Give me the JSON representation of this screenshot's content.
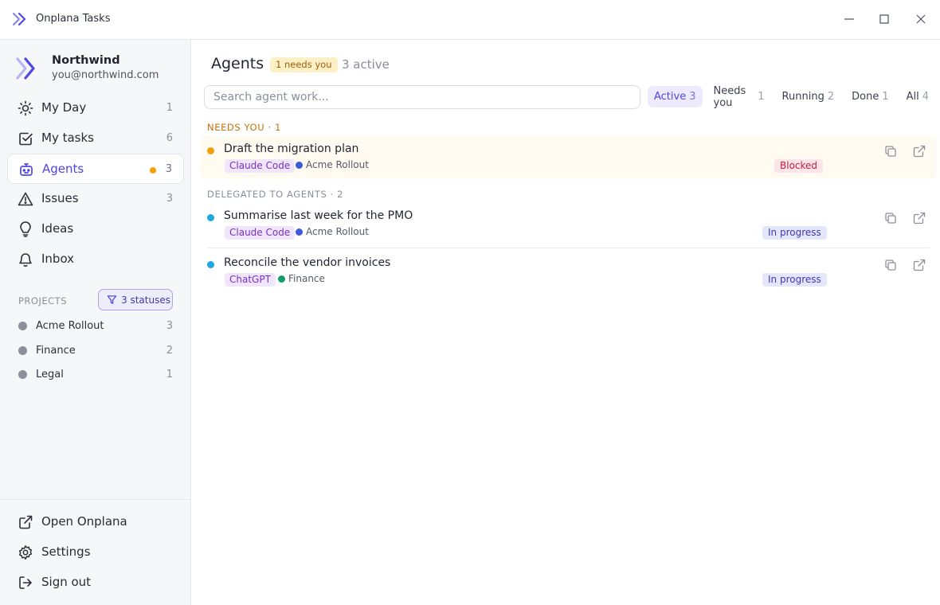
{
  "window": {
    "title": "Onplana Tasks",
    "controls": {
      "minimize": "minimize-icon",
      "maximize": "maximize-icon",
      "close": "close-icon"
    }
  },
  "sidebar": {
    "org": {
      "name": "Northwind",
      "email": "you@northwind.com"
    },
    "nav": [
      {
        "label": "My Day",
        "count": "1",
        "icon": "sun-icon"
      },
      {
        "label": "My tasks",
        "count": "6",
        "icon": "checkbox-icon"
      },
      {
        "label": "Agents",
        "count": "3",
        "icon": "robot-icon",
        "active": true,
        "alert": true
      },
      {
        "label": "Issues",
        "count": "3",
        "icon": "warning-icon"
      },
      {
        "label": "Ideas",
        "count": "",
        "icon": "lightbulb-icon"
      },
      {
        "label": "Inbox",
        "count": "",
        "icon": "bell-icon"
      }
    ],
    "projects_heading": "PROJECTS",
    "status_filter": "3 statuses",
    "projects": [
      {
        "label": "Acme Rollout",
        "count": "3"
      },
      {
        "label": "Finance",
        "count": "2"
      },
      {
        "label": "Legal",
        "count": "1"
      }
    ],
    "footer": [
      {
        "label": "Open Onplana",
        "icon": "external-link-icon"
      },
      {
        "label": "Settings",
        "icon": "gear-icon"
      },
      {
        "label": "Sign out",
        "icon": "sign-out-icon"
      }
    ]
  },
  "main": {
    "title": "Agents",
    "needs_badge": "1 needs you",
    "active_count": "3 active",
    "search": {
      "placeholder": "Search agent work...",
      "value": ""
    },
    "tabs": [
      {
        "label": "Active",
        "count": "3",
        "active": true
      },
      {
        "label": "Needs you",
        "count": "1"
      },
      {
        "label": "Running",
        "count": "2"
      },
      {
        "label": "Done",
        "count": "1"
      },
      {
        "label": "All",
        "count": "4"
      }
    ],
    "sections": [
      {
        "heading": "NEEDS YOU · 1",
        "tasks": [
          {
            "title": "Draft the migration plan",
            "agent": "Claude Code",
            "project": "Acme Rollout",
            "status": "Blocked"
          }
        ]
      },
      {
        "heading": "DELEGATED TO AGENTS · 2",
        "tasks": [
          {
            "title": "Summarise last week for the PMO",
            "agent": "Claude Code",
            "project": "Acme Rollout",
            "status": "In progress"
          },
          {
            "title": "Reconcile the vendor invoices",
            "agent": "ChatGPT",
            "project": "Finance",
            "status": "In progress"
          }
        ]
      }
    ]
  },
  "colors": {
    "accent": "#4f46e5",
    "needs_you": "#f59e0b",
    "in_progress_dot": "#1ea7e1",
    "blocked": "#c21f3f",
    "project_acme": "#3b5bdb",
    "project_finance": "#0f9d6b"
  }
}
